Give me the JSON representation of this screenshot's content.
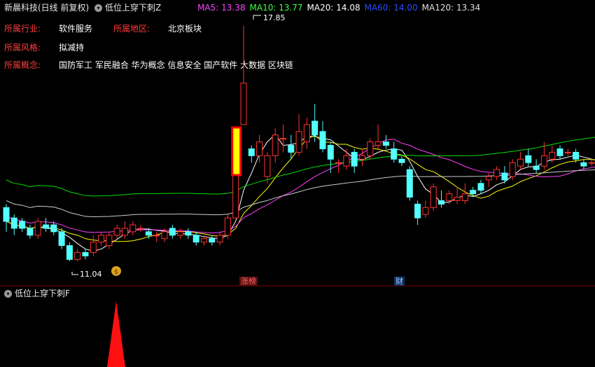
{
  "header": {
    "title": "新晨科技(日线 前复权)",
    "indicator_name": "低位上穿下刺Z",
    "ma": [
      {
        "label": "MA5: 13.38",
        "color": "#ff40ff"
      },
      {
        "label": "MA10: 13.77",
        "color": "#40ff40"
      },
      {
        "label": "MA20: 14.08",
        "color": "#ffffff"
      },
      {
        "label": "MA60: 14.00",
        "color": "#2a4bff"
      },
      {
        "label": "MA120: 13.34",
        "color": "#e0e0e0"
      }
    ]
  },
  "info": {
    "industry_label": "所属行业:",
    "industry_value": "软件服务",
    "region_label": "所属地区:",
    "region_value": "北京板块",
    "style_label": "所属风格:",
    "style_value": "拟减持",
    "concept_label": "所属概念:",
    "concept_value": "国防军工 军民融合 华为概念 信息安全 国产软件 大数据 区块链"
  },
  "annotations": {
    "high_label": "17.85",
    "low_label": "11.04",
    "tag_zhangbang": "涨榜",
    "tag_cai": "财"
  },
  "sub_panel": {
    "title": "低位上穿下刺F"
  },
  "colors": {
    "up": "#ff3232",
    "down": "#54ffff",
    "ma5": "#ffffff",
    "ma10": "#ffff00",
    "ma20": "#ff40ff",
    "ma60": "#00e000",
    "ma120": "#cccccc",
    "grid": "#800000"
  },
  "chart_data": {
    "type": "candlestick",
    "ylim": [
      10.5,
      18.2
    ],
    "candles": [
      [
        12.6,
        12.2,
        12.7,
        11.9
      ],
      [
        12.3,
        12.0,
        12.4,
        11.8
      ],
      [
        12.2,
        12.0,
        12.3,
        11.9
      ],
      [
        12.0,
        11.8,
        12.1,
        11.7
      ],
      [
        11.8,
        12.2,
        12.3,
        11.7
      ],
      [
        12.1,
        12.0,
        12.3,
        11.9
      ],
      [
        12.1,
        11.9,
        12.2,
        11.8
      ],
      [
        11.9,
        11.5,
        12.0,
        11.4
      ],
      [
        11.5,
        11.1,
        11.6,
        11.05
      ],
      [
        11.1,
        11.3,
        11.4,
        11.04
      ],
      [
        11.3,
        11.2,
        11.4,
        11.1
      ],
      [
        11.3,
        11.6,
        11.8,
        11.2
      ],
      [
        11.6,
        11.8,
        11.9,
        11.5
      ],
      [
        11.5,
        11.8,
        11.9,
        11.4
      ],
      [
        11.8,
        12.0,
        12.1,
        11.7
      ],
      [
        11.8,
        12.0,
        12.2,
        11.7
      ],
      [
        11.9,
        12.1,
        12.2,
        11.8
      ],
      [
        12.0,
        12.0,
        12.1,
        11.9
      ],
      [
        11.9,
        11.8,
        12.0,
        11.7
      ],
      [
        11.8,
        11.8,
        11.9,
        11.6
      ],
      [
        11.7,
        11.9,
        12.0,
        11.6
      ],
      [
        12.0,
        11.8,
        12.1,
        11.7
      ],
      [
        11.8,
        11.9,
        12.0,
        11.7
      ],
      [
        11.9,
        11.8,
        12.0,
        11.7
      ],
      [
        11.8,
        11.6,
        11.9,
        11.5
      ],
      [
        11.6,
        11.7,
        11.8,
        11.5
      ],
      [
        11.7,
        11.6,
        11.8,
        11.5
      ],
      [
        11.6,
        11.8,
        11.9,
        11.5
      ],
      [
        11.8,
        12.3,
        12.4,
        11.7
      ],
      [
        12.3,
        13.6,
        13.6,
        12.3
      ],
      [
        15.0,
        16.2,
        17.85,
        15.8
      ],
      [
        14.3,
        14.1,
        14.4,
        13.9
      ],
      [
        14.1,
        14.5,
        14.7,
        13.9
      ],
      [
        13.5,
        14.1,
        14.2,
        13.3
      ],
      [
        14.1,
        14.7,
        14.9,
        13.9
      ],
      [
        14.6,
        14.6,
        15.0,
        14.2
      ],
      [
        14.4,
        14.2,
        14.7,
        14.0
      ],
      [
        14.2,
        14.8,
        15.3,
        14.1
      ],
      [
        14.5,
        15.0,
        15.2,
        14.3
      ],
      [
        15.1,
        14.7,
        15.6,
        14.5
      ],
      [
        14.8,
        14.3,
        15.1,
        14.2
      ],
      [
        14.4,
        14.0,
        14.5,
        13.6
      ],
      [
        13.9,
        13.9,
        14.0,
        13.6
      ],
      [
        13.8,
        14.1,
        14.3,
        13.7
      ],
      [
        14.2,
        13.8,
        14.3,
        13.6
      ],
      [
        14.0,
        14.1,
        14.3,
        13.8
      ],
      [
        14.1,
        14.5,
        14.6,
        14.0
      ],
      [
        14.4,
        14.5,
        15.0,
        14.3
      ],
      [
        14.5,
        14.4,
        14.7,
        14.3
      ],
      [
        14.3,
        14.0,
        14.5,
        13.9
      ],
      [
        14.0,
        13.9,
        14.1,
        13.8
      ],
      [
        13.7,
        12.9,
        13.8,
        12.8
      ],
      [
        12.7,
        12.3,
        12.8,
        12.1
      ],
      [
        12.4,
        12.6,
        12.8,
        12.3
      ],
      [
        12.6,
        13.2,
        13.3,
        12.5
      ],
      [
        12.8,
        12.7,
        13.1,
        12.6
      ],
      [
        12.8,
        13.0,
        13.1,
        12.7
      ],
      [
        12.8,
        12.9,
        13.2,
        12.7
      ],
      [
        12.8,
        13.0,
        13.3,
        12.7
      ],
      [
        13.1,
        13.0,
        13.2,
        12.9
      ],
      [
        13.3,
        13.1,
        13.4,
        13.0
      ],
      [
        13.4,
        13.5,
        13.6,
        13.2
      ],
      [
        13.5,
        13.7,
        13.8,
        13.4
      ],
      [
        13.6,
        13.4,
        13.8,
        13.3
      ],
      [
        13.5,
        13.9,
        14.0,
        13.4
      ],
      [
        13.8,
        14.0,
        14.2,
        13.7
      ],
      [
        14.1,
        13.9,
        14.3,
        13.8
      ],
      [
        13.8,
        13.7,
        14.0,
        13.6
      ],
      [
        13.8,
        14.1,
        14.5,
        13.7
      ],
      [
        14.0,
        14.2,
        14.4,
        13.9
      ],
      [
        14.3,
        14.1,
        14.4,
        14.0
      ],
      [
        14.2,
        14.2,
        14.3,
        14.1
      ],
      [
        14.2,
        14.0,
        14.3,
        13.9
      ],
      [
        13.9,
        13.8,
        14.0,
        13.7
      ],
      [
        13.9,
        13.9,
        14.0,
        13.8
      ],
      [
        13.9,
        13.8,
        14.0,
        13.7
      ],
      [
        13.7,
        13.9,
        14.0,
        13.6
      ]
    ],
    "signal_index": 30
  }
}
